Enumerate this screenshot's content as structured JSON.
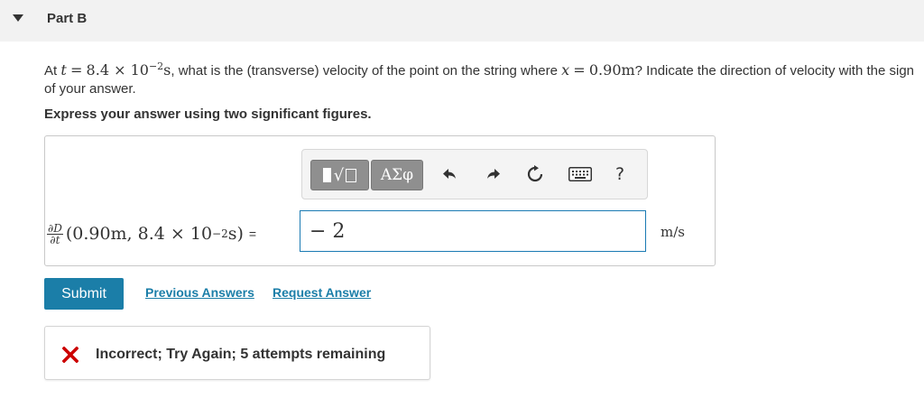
{
  "part": {
    "title": "Part B"
  },
  "question": {
    "at": "At",
    "t_var": "t",
    "eq": "=",
    "t_mantissa": "8.4 × 10",
    "t_exp": "−2",
    "t_unit": "s",
    "mid_text": ", what is the (transverse) velocity of the point on the string where",
    "x_var": "x",
    "x_val": "0.90m",
    "end_text": "? Indicate the direction of velocity with the sign of your answer."
  },
  "instruction": "Express your answer using two significant figures.",
  "toolbar": {
    "templates_icon": "templates-icon",
    "symbols_label": "ΑΣφ",
    "undo_icon": "undo-icon",
    "redo_icon": "redo-icon",
    "reset_icon": "reset-icon",
    "keyboard_icon": "keyboard-icon",
    "help_label": "?"
  },
  "equation": {
    "num": "∂D",
    "den": "∂t",
    "args_open": "(0.90m, 8.4 × 10",
    "args_exp": "−2",
    "args_close": "s)",
    "equals": "="
  },
  "answer": {
    "value": "− 2",
    "units": "m/s"
  },
  "actions": {
    "submit_label": "Submit",
    "previous_answers": "Previous Answers",
    "request_answer": "Request Answer"
  },
  "feedback": {
    "icon": "incorrect-x-icon",
    "text": "Incorrect; Try Again; 5 attempts remaining",
    "color": "#cc0000"
  },
  "colors": {
    "accent": "#1b7ea8",
    "header_bg": "#f2f2f2"
  }
}
